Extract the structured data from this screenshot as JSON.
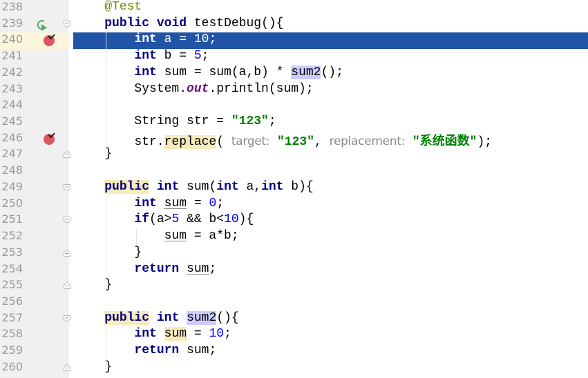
{
  "editor": {
    "colors": {
      "current_line_bg": "#2154a6",
      "breakpoint_line_bg": "#faeae6",
      "keyword": "#000080",
      "number": "#0000ff",
      "string": "#008000",
      "annotation": "#808000",
      "static_field": "#660e7a"
    },
    "lines": [
      {
        "number": "238",
        "tokens": [
          {
            "t": "    "
          },
          {
            "t": "@Test",
            "k": "ann"
          }
        ]
      },
      {
        "number": "239",
        "gutter_icon": "run-test-icon",
        "fold": "fold-open",
        "tokens": [
          {
            "t": "    "
          },
          {
            "t": "public",
            "k": "kw"
          },
          {
            "t": " "
          },
          {
            "t": "void",
            "k": "kw"
          },
          {
            "t": " testDebug(){"
          }
        ]
      },
      {
        "number": "240",
        "state": "current",
        "gutter_icon": "breakpoint-verified-icon",
        "tokens": [
          {
            "t": "        "
          },
          {
            "t": "int",
            "k": "kw"
          },
          {
            "t": " a = "
          },
          {
            "t": "10",
            "k": "num"
          },
          {
            "t": ";"
          }
        ]
      },
      {
        "number": "241",
        "tokens": [
          {
            "t": "        "
          },
          {
            "t": "int",
            "k": "kw"
          },
          {
            "t": " b = "
          },
          {
            "t": "5",
            "k": "num"
          },
          {
            "t": ";"
          }
        ]
      },
      {
        "number": "242",
        "tokens": [
          {
            "t": "        "
          },
          {
            "t": "int",
            "k": "kw"
          },
          {
            "t": " sum = sum(a,b) * "
          },
          {
            "t": "sum2",
            "k": "hl-b"
          },
          {
            "t": "();"
          }
        ]
      },
      {
        "number": "243",
        "tokens": [
          {
            "t": "        System."
          },
          {
            "t": "out",
            "k": "fld"
          },
          {
            "t": ".println(sum);"
          }
        ]
      },
      {
        "number": "244",
        "tokens": []
      },
      {
        "number": "245",
        "tokens": [
          {
            "t": "        String str = "
          },
          {
            "t": "\"123\"",
            "k": "str"
          },
          {
            "t": ";"
          }
        ]
      },
      {
        "number": "246",
        "state": "breakpoint",
        "gutter_icon": "breakpoint-verified-icon",
        "tokens": [
          {
            "t": "        str."
          },
          {
            "t": "replace",
            "k": "hl-y"
          },
          {
            "t": "( "
          },
          {
            "t": "target:",
            "k": "hint"
          },
          {
            "t": " "
          },
          {
            "t": "\"123\"",
            "k": "str"
          },
          {
            "t": ", "
          },
          {
            "t": "replacement:",
            "k": "hint"
          },
          {
            "t": " "
          },
          {
            "t": "\"系统函数\"",
            "k": "str"
          },
          {
            "t": ");"
          }
        ]
      },
      {
        "number": "247",
        "fold": "fold-close",
        "tokens": [
          {
            "t": "    }"
          }
        ]
      },
      {
        "number": "248",
        "tokens": []
      },
      {
        "number": "249",
        "fold": "fold-open",
        "tokens": [
          {
            "t": "    "
          },
          {
            "t": "public",
            "k": "kw hl-y"
          },
          {
            "t": " "
          },
          {
            "t": "int",
            "k": "kw"
          },
          {
            "t": " sum("
          },
          {
            "t": "int",
            "k": "kw"
          },
          {
            "t": " a,"
          },
          {
            "t": "int",
            "k": "kw"
          },
          {
            "t": " b){"
          }
        ]
      },
      {
        "number": "250",
        "tokens": [
          {
            "t": "        "
          },
          {
            "t": "int",
            "k": "kw"
          },
          {
            "t": " "
          },
          {
            "t": "sum",
            "k": "ul"
          },
          {
            "t": " = "
          },
          {
            "t": "0",
            "k": "num"
          },
          {
            "t": ";"
          }
        ]
      },
      {
        "number": "251",
        "fold": "fold-open",
        "tokens": [
          {
            "t": "        "
          },
          {
            "t": "if",
            "k": "kw"
          },
          {
            "t": "(a>"
          },
          {
            "t": "5",
            "k": "num"
          },
          {
            "t": " && b<"
          },
          {
            "t": "10",
            "k": "num"
          },
          {
            "t": "){"
          }
        ]
      },
      {
        "number": "252",
        "tokens": [
          {
            "t": "            "
          },
          {
            "t": "sum",
            "k": "ul"
          },
          {
            "t": " = a*b;"
          }
        ]
      },
      {
        "number": "253",
        "fold": "fold-close",
        "tokens": [
          {
            "t": "        }"
          }
        ]
      },
      {
        "number": "254",
        "tokens": [
          {
            "t": "        "
          },
          {
            "t": "return",
            "k": "kw"
          },
          {
            "t": " "
          },
          {
            "t": "sum",
            "k": "ul"
          },
          {
            "t": ";"
          }
        ]
      },
      {
        "number": "255",
        "fold": "fold-close",
        "tokens": [
          {
            "t": "    }"
          }
        ]
      },
      {
        "number": "256",
        "tokens": []
      },
      {
        "number": "257",
        "fold": "fold-open",
        "tokens": [
          {
            "t": "    "
          },
          {
            "t": "public",
            "k": "kw hl-y"
          },
          {
            "t": " "
          },
          {
            "t": "int",
            "k": "kw"
          },
          {
            "t": " "
          },
          {
            "t": "sum2",
            "k": "hl-b"
          },
          {
            "t": "(){"
          }
        ]
      },
      {
        "number": "258",
        "tokens": [
          {
            "t": "        "
          },
          {
            "t": "int",
            "k": "kw"
          },
          {
            "t": " "
          },
          {
            "t": "sum",
            "k": "hl-y"
          },
          {
            "t": " = "
          },
          {
            "t": "10",
            "k": "num"
          },
          {
            "t": ";"
          }
        ]
      },
      {
        "number": "259",
        "tokens": [
          {
            "t": "        "
          },
          {
            "t": "return",
            "k": "kw"
          },
          {
            "t": " sum;"
          }
        ]
      },
      {
        "number": "260",
        "fold": "fold-close",
        "tokens": [
          {
            "t": "    }"
          }
        ]
      }
    ]
  }
}
